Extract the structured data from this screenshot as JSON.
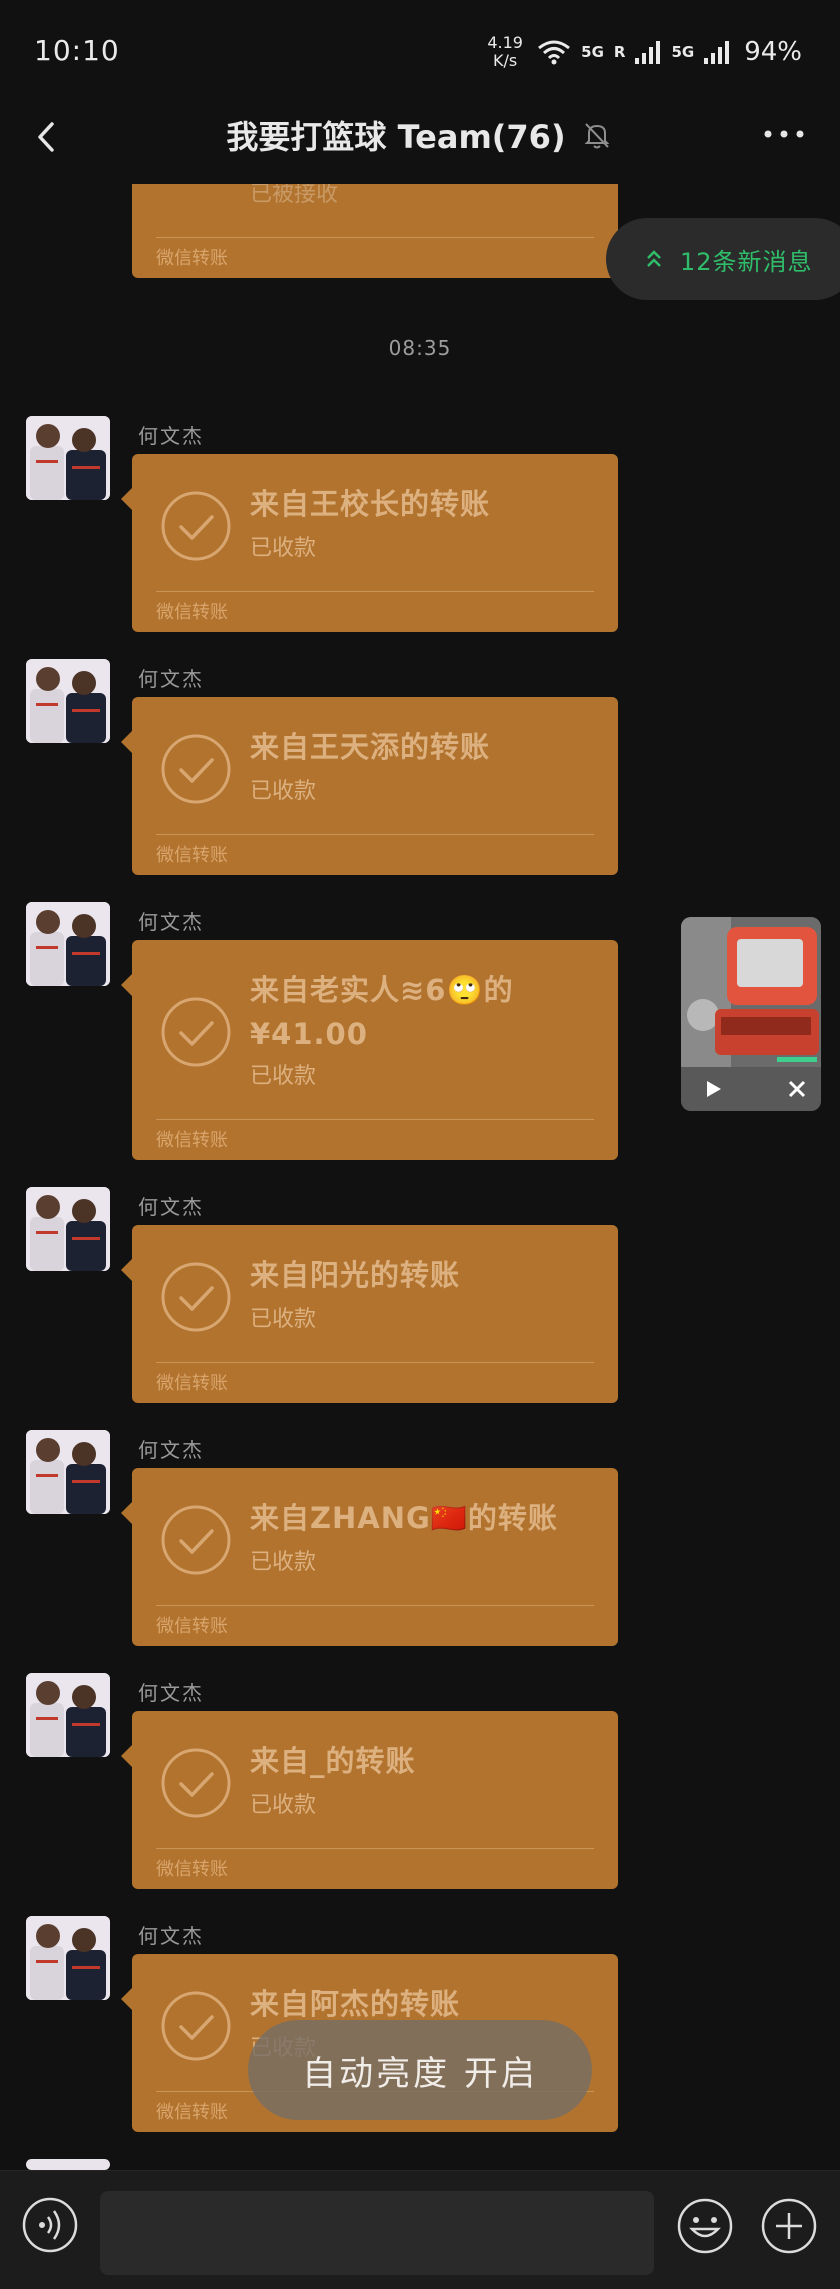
{
  "status_bar": {
    "time": "10:10",
    "net_speed_value": "4.19",
    "net_speed_unit": "K/s",
    "sig1": "5G",
    "sig_r": "R",
    "sig2": "5G",
    "battery": "94%"
  },
  "header": {
    "title": "我要打篮球 Team(76)"
  },
  "chat": {
    "timestamp": "08:35",
    "new_messages": "12条新消息",
    "partial_card": {
      "sub": "已被接收",
      "footer": "微信转账"
    },
    "messages": [
      {
        "sender": "何文杰",
        "title": "来自王校长的转账",
        "sub": "已收款",
        "footer": "微信转账"
      },
      {
        "sender": "何文杰",
        "title": "来自王天添的转账",
        "sub": "已收款",
        "footer": "微信转账"
      },
      {
        "sender": "何文杰",
        "title": "来自老实人≋6🙄的",
        "amount": "¥41.00",
        "sub": "已收款",
        "footer": "微信转账"
      },
      {
        "sender": "何文杰",
        "title": "来自阳光的转账",
        "sub": "已收款",
        "footer": "微信转账"
      },
      {
        "sender": "何文杰",
        "title": "来自ZHANG🇨🇳的转账",
        "sub": "已收款",
        "footer": "微信转账"
      },
      {
        "sender": "何文杰",
        "title": "来自_的转账",
        "sub": "已收款",
        "footer": "微信转账"
      },
      {
        "sender": "何文杰",
        "title": "来自阿杰的转账",
        "sub": "已收款",
        "footer": "微信转账"
      }
    ]
  },
  "toast": {
    "text": "自动亮度 开启"
  },
  "icons": {
    "back": "back-arrow-icon",
    "mute": "bell-off-icon",
    "more": "more-dots-icon",
    "voice": "voice-icon",
    "emoji": "emoji-icon",
    "plus": "plus-icon",
    "check": "check-circle-icon"
  },
  "colors": {
    "card": "#b1732e",
    "accent_green": "#2fbd6a",
    "background": "#111111"
  }
}
